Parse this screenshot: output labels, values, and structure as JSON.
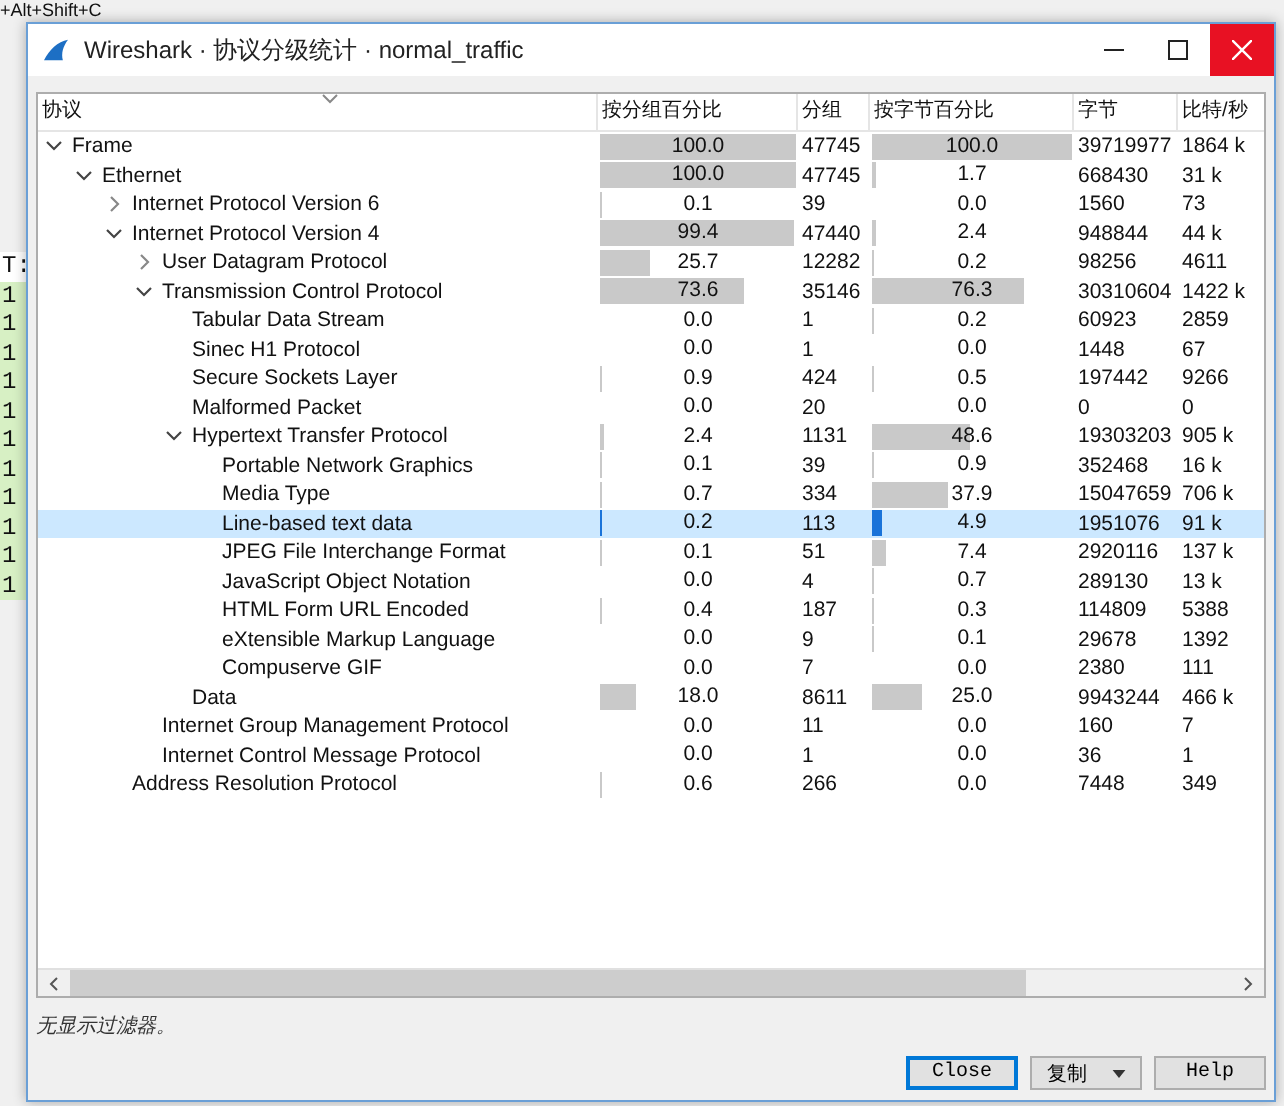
{
  "background": {
    "top_text": "+Alt+Shift+C",
    "column_cells": [
      "T:",
      "1",
      "1",
      "1",
      "1",
      "1",
      "1",
      "1",
      "1",
      "1",
      "1",
      "1"
    ]
  },
  "window": {
    "title": "Wireshark · 协议分级统计 · normal_traffic"
  },
  "table": {
    "columns": [
      "协议",
      "按分组百分比",
      "分组",
      "按字节百分比",
      "字节",
      "比特/秒"
    ],
    "rows": [
      {
        "protocol": "Frame",
        "expanded": true,
        "selected": false,
        "pct_packets": {
          "text": "100.0",
          "level": 1.0
        },
        "packets": "47745",
        "pct_bytes": {
          "text": "100.0",
          "level": 1.0
        },
        "bytes": "39719977",
        "bits": "1864 k",
        "children": [
          {
            "protocol": "Ethernet",
            "expanded": true,
            "selected": false,
            "pct_packets": {
              "text": "100.0",
              "level": 1.0
            },
            "packets": "47745",
            "pct_bytes": {
              "text": "1.7",
              "level": 0.017
            },
            "bytes": "668430",
            "bits": "31 k",
            "children": [
              {
                "protocol": "Internet Protocol Version 6",
                "expanded": false,
                "selected": false,
                "pct_packets": {
                  "text": "0.1",
                  "level": 0.001
                },
                "packets": "39",
                "pct_bytes": {
                  "text": "0.0",
                  "level": 0.0
                },
                "bytes": "1560",
                "bits": "73"
              },
              {
                "protocol": "Internet Protocol Version 4",
                "expanded": true,
                "selected": false,
                "pct_packets": {
                  "text": "99.4",
                  "level": 0.994
                },
                "packets": "47440",
                "pct_bytes": {
                  "text": "2.4",
                  "level": 0.024
                },
                "bytes": "948844",
                "bits": "44 k",
                "children": [
                  {
                    "protocol": "User Datagram Protocol",
                    "expanded": false,
                    "selected": false,
                    "pct_packets": {
                      "text": "25.7",
                      "level": 0.257
                    },
                    "packets": "12282",
                    "pct_bytes": {
                      "text": "0.2",
                      "level": 0.002
                    },
                    "bytes": "98256",
                    "bits": "4611"
                  },
                  {
                    "protocol": "Transmission Control Protocol",
                    "expanded": true,
                    "selected": false,
                    "pct_packets": {
                      "text": "73.6",
                      "level": 0.736
                    },
                    "packets": "35146",
                    "pct_bytes": {
                      "text": "76.3",
                      "level": 0.763
                    },
                    "bytes": "30310604",
                    "bits": "1422 k",
                    "children": [
                      {
                        "protocol": "Tabular Data Stream",
                        "selected": false,
                        "pct_packets": {
                          "text": "0.0",
                          "level": 0.0
                        },
                        "packets": "1",
                        "pct_bytes": {
                          "text": "0.2",
                          "level": 0.002
                        },
                        "bytes": "60923",
                        "bits": "2859"
                      },
                      {
                        "protocol": "Sinec H1 Protocol",
                        "selected": false,
                        "pct_packets": {
                          "text": "0.0",
                          "level": 0.0
                        },
                        "packets": "1",
                        "pct_bytes": {
                          "text": "0.0",
                          "level": 0.0
                        },
                        "bytes": "1448",
                        "bits": "67"
                      },
                      {
                        "protocol": "Secure Sockets Layer",
                        "selected": false,
                        "pct_packets": {
                          "text": "0.9",
                          "level": 0.009
                        },
                        "packets": "424",
                        "pct_bytes": {
                          "text": "0.5",
                          "level": 0.005
                        },
                        "bytes": "197442",
                        "bits": "9266"
                      },
                      {
                        "protocol": "Malformed Packet",
                        "selected": false,
                        "pct_packets": {
                          "text": "0.0",
                          "level": 0.0
                        },
                        "packets": "20",
                        "pct_bytes": {
                          "text": "0.0",
                          "level": 0.0
                        },
                        "bytes": "0",
                        "bits": "0"
                      },
                      {
                        "protocol": "Hypertext Transfer Protocol",
                        "expanded": true,
                        "selected": false,
                        "pct_packets": {
                          "text": "2.4",
                          "level": 0.024
                        },
                        "packets": "1131",
                        "pct_bytes": {
                          "text": "48.6",
                          "level": 0.486
                        },
                        "bytes": "19303203",
                        "bits": "905 k",
                        "children": [
                          {
                            "protocol": "Portable Network Graphics",
                            "selected": false,
                            "pct_packets": {
                              "text": "0.1",
                              "level": 0.001
                            },
                            "packets": "39",
                            "pct_bytes": {
                              "text": "0.9",
                              "level": 0.009
                            },
                            "bytes": "352468",
                            "bits": "16 k"
                          },
                          {
                            "protocol": "Media Type",
                            "selected": false,
                            "pct_packets": {
                              "text": "0.7",
                              "level": 0.007
                            },
                            "packets": "334",
                            "pct_bytes": {
                              "text": "37.9",
                              "level": 0.379
                            },
                            "bytes": "15047659",
                            "bits": "706 k"
                          },
                          {
                            "protocol": "Line-based text data",
                            "selected": true,
                            "pct_packets": {
                              "text": "0.2",
                              "level": 0.002
                            },
                            "packets": "113",
                            "pct_bytes": {
                              "text": "4.9",
                              "level": 0.049
                            },
                            "bytes": "1951076",
                            "bits": "91 k"
                          },
                          {
                            "protocol": "JPEG File Interchange Format",
                            "selected": false,
                            "pct_packets": {
                              "text": "0.1",
                              "level": 0.001
                            },
                            "packets": "51",
                            "pct_bytes": {
                              "text": "7.4",
                              "level": 0.074
                            },
                            "bytes": "2920116",
                            "bits": "137 k"
                          },
                          {
                            "protocol": "JavaScript Object Notation",
                            "selected": false,
                            "pct_packets": {
                              "text": "0.0",
                              "level": 0.0
                            },
                            "packets": "4",
                            "pct_bytes": {
                              "text": "0.7",
                              "level": 0.007
                            },
                            "bytes": "289130",
                            "bits": "13 k"
                          },
                          {
                            "protocol": "HTML Form URL Encoded",
                            "selected": false,
                            "pct_packets": {
                              "text": "0.4",
                              "level": 0.004
                            },
                            "packets": "187",
                            "pct_bytes": {
                              "text": "0.3",
                              "level": 0.003
                            },
                            "bytes": "114809",
                            "bits": "5388"
                          },
                          {
                            "protocol": "eXtensible Markup Language",
                            "selected": false,
                            "pct_packets": {
                              "text": "0.0",
                              "level": 0.0
                            },
                            "packets": "9",
                            "pct_bytes": {
                              "text": "0.1",
                              "level": 0.001
                            },
                            "bytes": "29678",
                            "bits": "1392"
                          },
                          {
                            "protocol": "Compuserve GIF",
                            "selected": false,
                            "pct_packets": {
                              "text": "0.0",
                              "level": 0.0
                            },
                            "packets": "7",
                            "pct_bytes": {
                              "text": "0.0",
                              "level": 0.0
                            },
                            "bytes": "2380",
                            "bits": "111"
                          }
                        ]
                      },
                      {
                        "protocol": "Data",
                        "selected": false,
                        "pct_packets": {
                          "text": "18.0",
                          "level": 0.18
                        },
                        "packets": "8611",
                        "pct_bytes": {
                          "text": "25.0",
                          "level": 0.25
                        },
                        "bytes": "9943244",
                        "bits": "466 k"
                      }
                    ]
                  },
                  {
                    "protocol": "Internet Group Management Protocol",
                    "selected": false,
                    "pct_packets": {
                      "text": "0.0",
                      "level": 0.0
                    },
                    "packets": "11",
                    "pct_bytes": {
                      "text": "0.0",
                      "level": 0.0
                    },
                    "bytes": "160",
                    "bits": "7"
                  },
                  {
                    "protocol": "Internet Control Message Protocol",
                    "selected": false,
                    "pct_packets": {
                      "text": "0.0",
                      "level": 0.0
                    },
                    "packets": "1",
                    "pct_bytes": {
                      "text": "0.0",
                      "level": 0.0
                    },
                    "bytes": "36",
                    "bits": "1"
                  }
                ]
              },
              {
                "protocol": "Address Resolution Protocol",
                "selected": false,
                "pct_packets": {
                  "text": "0.6",
                  "level": 0.006
                },
                "packets": "266",
                "pct_bytes": {
                  "text": "0.0",
                  "level": 0.0
                },
                "bytes": "7448",
                "bits": "349"
              }
            ]
          }
        ]
      }
    ]
  },
  "status_bar": {
    "text": "无显示过滤器。"
  },
  "buttons": [
    {
      "kind": "plain",
      "label": "Close",
      "focused": true
    },
    {
      "kind": "dropdown",
      "label": "复制",
      "focused": false
    },
    {
      "kind": "plain",
      "label": "Help",
      "focused": false
    }
  ]
}
